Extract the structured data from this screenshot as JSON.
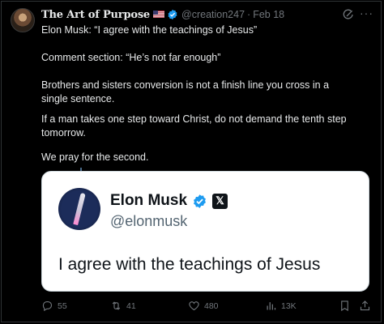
{
  "post": {
    "author_name": "The Art of Purpose",
    "author_flag": "US flag",
    "handle": "@creation247",
    "separator": "·",
    "date": "Feb 18",
    "paragraphs": [
      "Elon Musk: “I agree with the teachings of Jesus”",
      "Comment section: “He’s not far enough”",
      "Brothers and sisters conversion is not a finish line you cross in a single sentence.",
      "If a man takes one step toward Christ, do not demand the tenth step tomorrow.",
      "We pray for the second."
    ]
  },
  "quoted": {
    "name": "Elon Musk",
    "handle": "@elonmusk",
    "text": "I agree with the teachings of Jesus",
    "x_badge": "𝕏"
  },
  "actions": {
    "replies": "55",
    "reposts": "41",
    "likes": "480",
    "views": "13K"
  },
  "icons": {
    "flag": "us-flag-icon",
    "verified": "verified-badge-icon",
    "grok": "grok-icon",
    "more": "more-icon",
    "reply": "reply-icon",
    "repost": "repost-icon",
    "like": "heart-icon",
    "views": "views-icon",
    "bookmark": "bookmark-icon",
    "share": "share-icon"
  },
  "colors": {
    "background": "#000000",
    "text": "#e7e9ea",
    "muted": "#71767b",
    "verified": "#1d9bf0",
    "card": "#ffffff"
  }
}
